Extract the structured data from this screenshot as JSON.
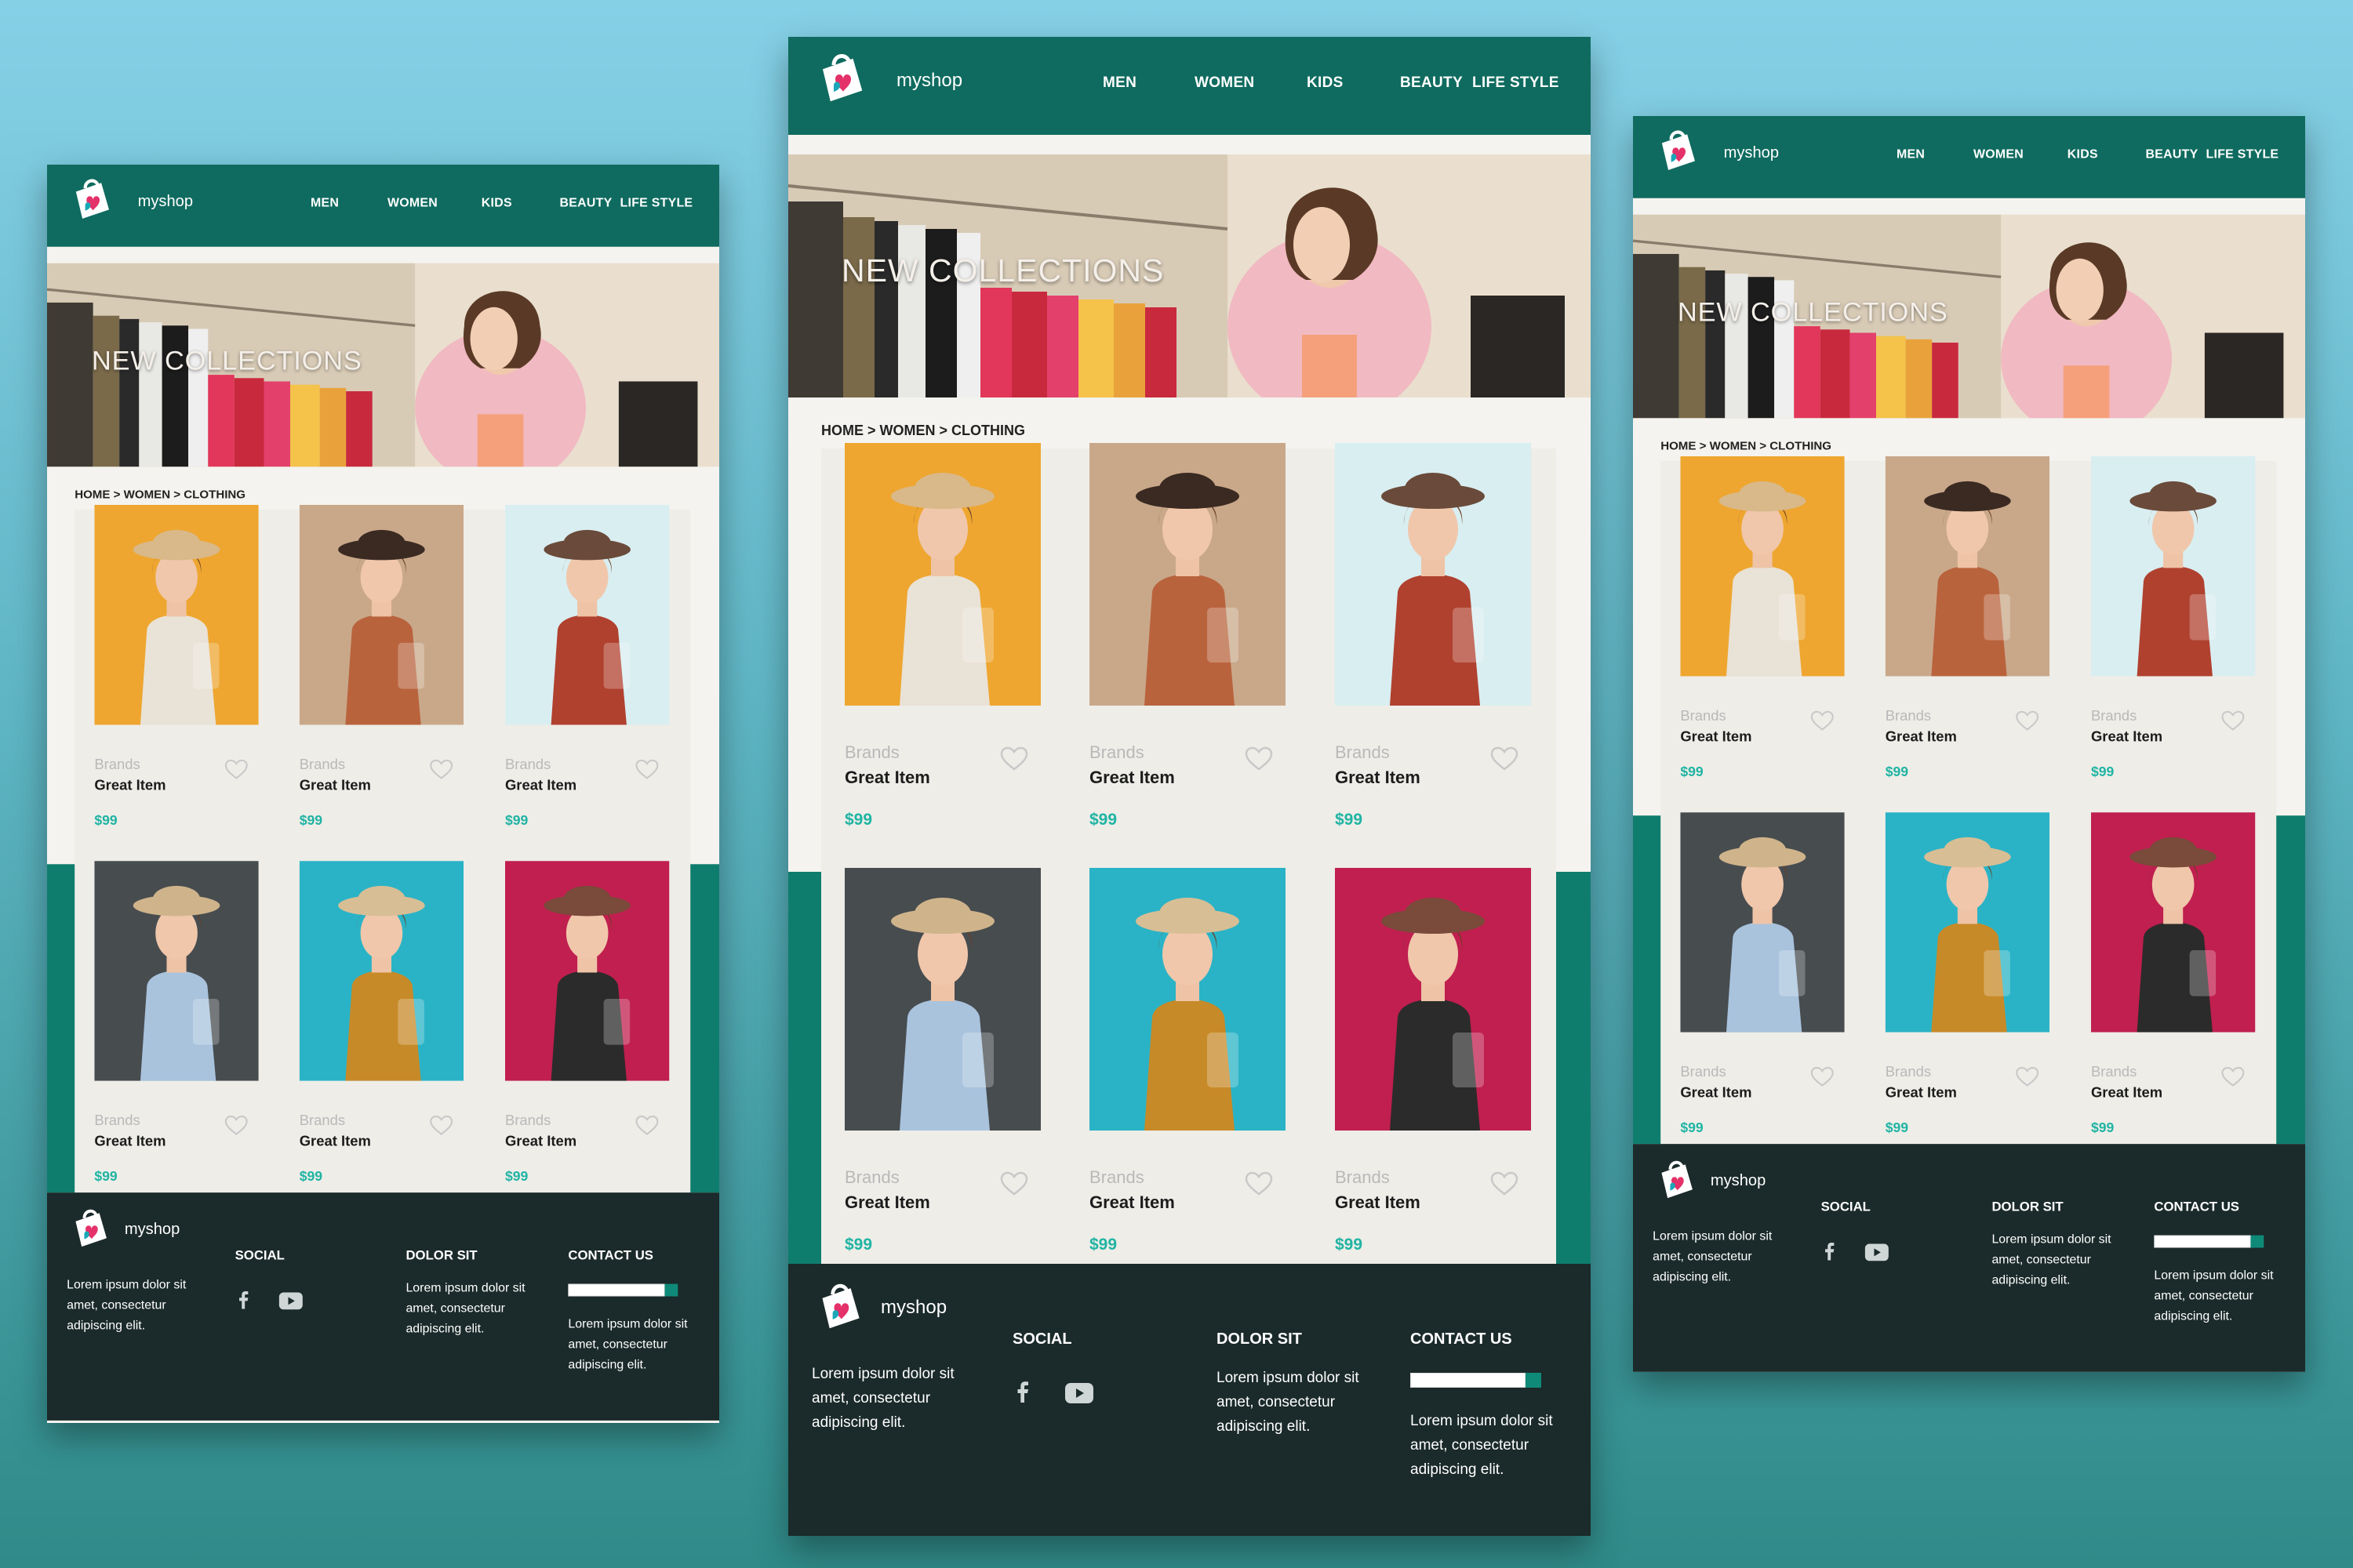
{
  "site": {
    "brand": "myshop"
  },
  "nav": [
    "MEN",
    "WOMEN",
    "KIDS",
    "BEAUTY",
    "LIFE STYLE"
  ],
  "hero": {
    "title": "NEW COLLECTIONS"
  },
  "breadcrumb": "HOME > WOMEN > CLOTHING",
  "products": [
    {
      "brand": "Brands",
      "name": "Great Item",
      "price": "$99",
      "bg": "#eea630",
      "dress": "#e9e2d6",
      "hat": "#d9b889"
    },
    {
      "brand": "Brands",
      "name": "Great Item",
      "price": "$99",
      "bg": "#c9a88a",
      "dress": "#b9633d",
      "hat": "#3a2a22"
    },
    {
      "brand": "Brands",
      "name": "Great Item",
      "price": "$99",
      "bg": "#d9eef1",
      "dress": "#b0412f",
      "hat": "#6a4a3a"
    },
    {
      "brand": "Brands",
      "name": "Great Item",
      "price": "$99",
      "bg": "#474c4f",
      "dress": "#a9c3dd",
      "hat": "#cfb48b"
    },
    {
      "brand": "Brands",
      "name": "Great Item",
      "price": "$99",
      "bg": "#2ab3c6",
      "dress": "#c78a28",
      "hat": "#d8be95"
    },
    {
      "brand": "Brands",
      "name": "Great Item",
      "price": "$99",
      "bg": "#c01f4f",
      "dress": "#2b2b2b",
      "hat": "#7a4a3a"
    }
  ],
  "footer": {
    "about": "Lorem ipsum dolor sit amet, consectetur adipiscing elit.",
    "social_heading": "SOCIAL",
    "dolor_heading": "DOLOR SIT",
    "dolor_text": "Lorem ipsum dolor sit amet, consectetur adipiscing elit.",
    "contact_heading": "CONTACT US",
    "contact_text": "Lorem ipsum dolor sit amet, consectetur adipiscing elit."
  },
  "colors": {
    "header": "#0f6b5f",
    "accent": "#20b4a3",
    "footer": "#1b2a2a",
    "band": "#0f7d6e"
  },
  "icons": [
    "shopping-bag-logo-icon",
    "heart-icon",
    "facebook-icon",
    "youtube-icon"
  ]
}
